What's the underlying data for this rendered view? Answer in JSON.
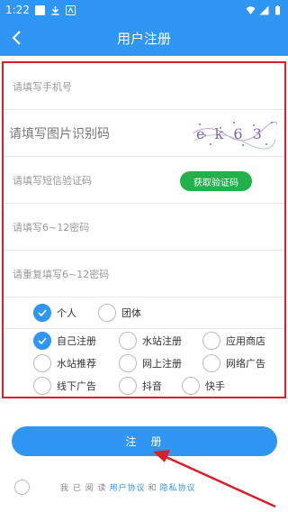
{
  "status": {
    "time": "1:22"
  },
  "header": {
    "title": "用户注册"
  },
  "form": {
    "phone_placeholder": "请填写手机号",
    "captcha_placeholder": "请填写图片识别码",
    "captcha_text": "e k 6 3",
    "sms_placeholder": "请填写短信验证码",
    "get_code_label": "获取验证码",
    "password_placeholder": "请填写6~12密码",
    "confirm_placeholder": "请重复填写6~12密码"
  },
  "account_types": [
    {
      "label": "个人",
      "selected": true
    },
    {
      "label": "团体",
      "selected": false
    }
  ],
  "sources": [
    {
      "label": "自己注册",
      "selected": true
    },
    {
      "label": "水站注册",
      "selected": false
    },
    {
      "label": "应用商店",
      "selected": false
    },
    {
      "label": "水站推荐",
      "selected": false
    },
    {
      "label": "网上注册",
      "selected": false
    },
    {
      "label": "网络广告",
      "selected": false
    },
    {
      "label": "线下广告",
      "selected": false
    },
    {
      "label": "抖音",
      "selected": false
    },
    {
      "label": "快手",
      "selected": false
    }
  ],
  "register_label": "注　册",
  "agreement": {
    "prefix": "我 已 阅 读",
    "user_agreement": "用户协议",
    "and": "和",
    "privacy": "隐私协议"
  },
  "colors": {
    "primary": "#2f96f3",
    "highlight": "#d9202a",
    "green": "#22b24c"
  }
}
